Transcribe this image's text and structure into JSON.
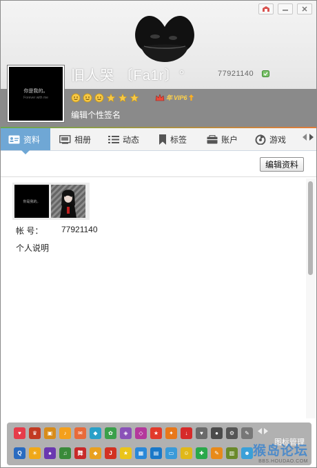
{
  "header": {
    "nickname": "旧人哭  〔Fa1r〕°",
    "qq_number": "77921140",
    "signature": "编辑个性签名",
    "vip_label": "VIP6",
    "vip_prefix": "年",
    "avatar_text": "你是我的。",
    "avatar_subtext": "Forever with me"
  },
  "tabs": [
    {
      "label": "资料",
      "icon": "profile-card-icon",
      "active": true
    },
    {
      "label": "相册",
      "icon": "photo-album-icon",
      "active": false
    },
    {
      "label": "动态",
      "icon": "feed-list-icon",
      "active": false
    },
    {
      "label": "标签",
      "icon": "bookmark-tag-icon",
      "active": false
    },
    {
      "label": "账户",
      "icon": "wallet-icon",
      "active": false
    },
    {
      "label": "游戏",
      "icon": "game-icon",
      "active": false
    }
  ],
  "content": {
    "edit_button": "编辑资料",
    "account_label": "帐    号：",
    "account_value": "77921140",
    "personal_description": "个人说明",
    "thumb1_text": "你是我的。"
  },
  "footer": {
    "icon_management": "图标管理",
    "watermark_main": "猴岛论坛",
    "watermark_sub": "BBS.HOUDAO.COM"
  },
  "colors": {
    "active_tab": "#6fa7d5",
    "header_band": "#8a8a8a",
    "footer_bg": "#b1b1b1",
    "accent_green": "#6aa84f",
    "accent_orange": "#e07b39"
  }
}
